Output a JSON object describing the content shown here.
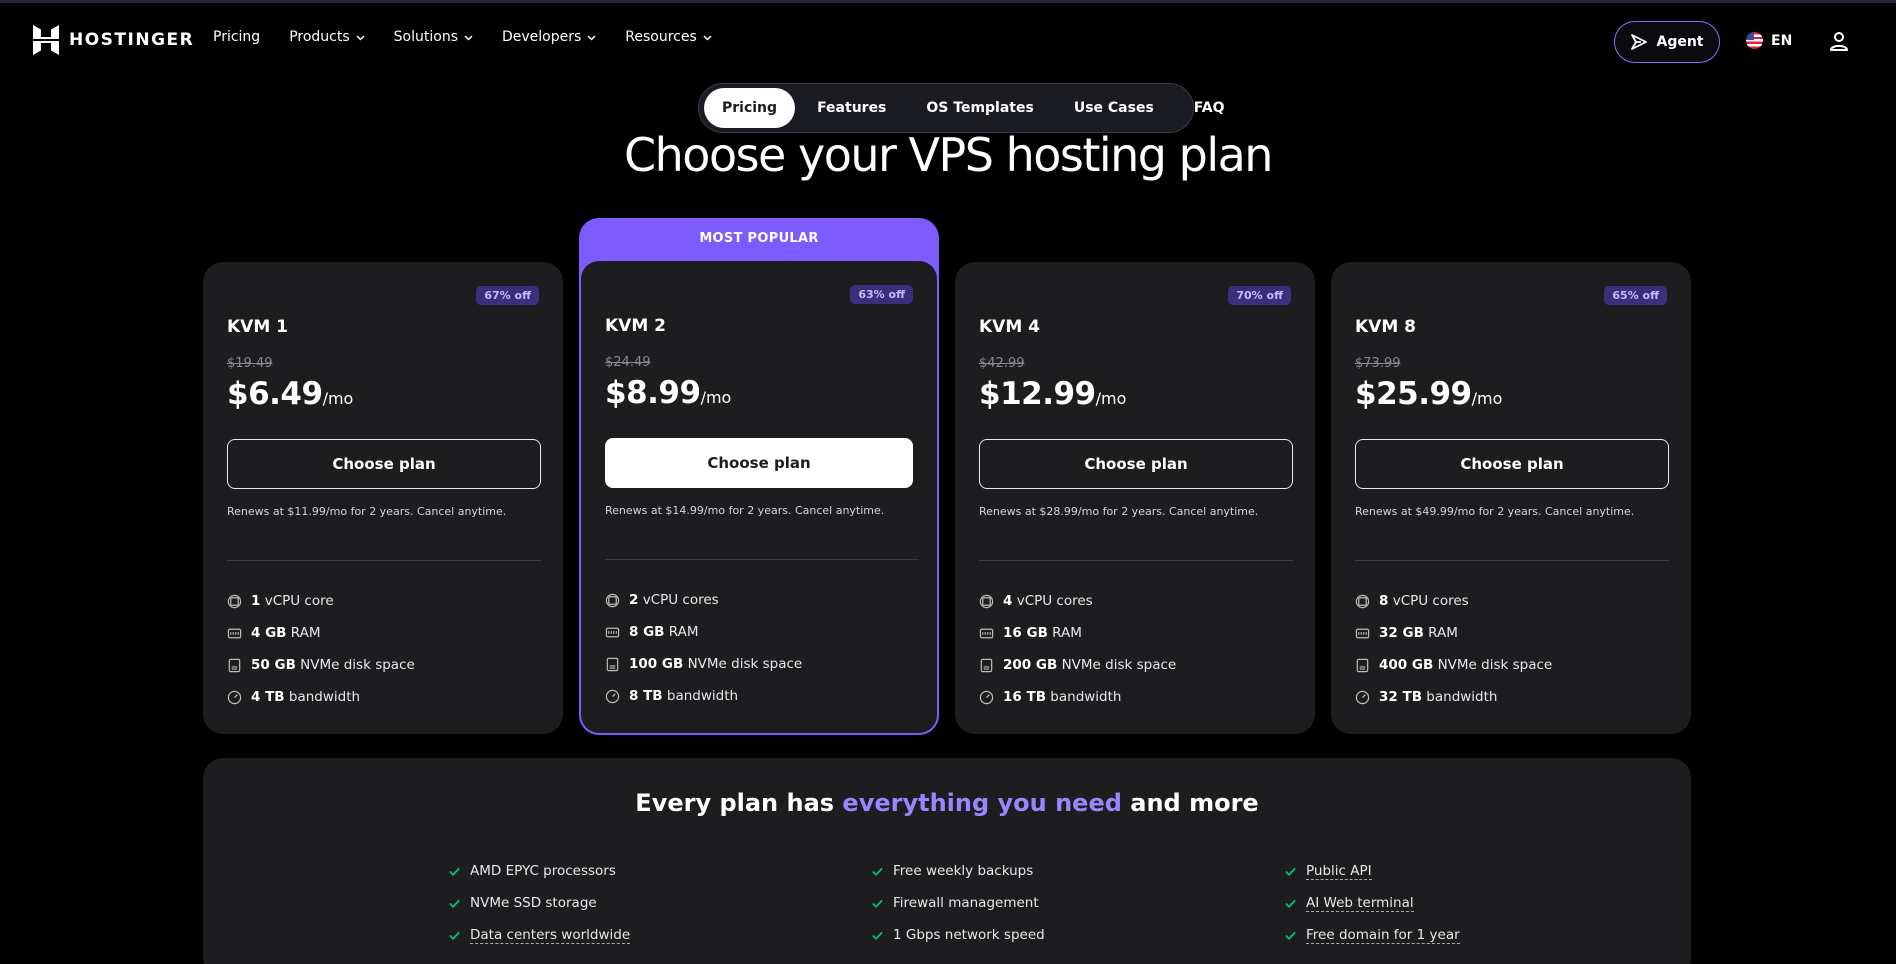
{
  "brand": {
    "name": "HOSTINGER"
  },
  "nav": {
    "links": [
      {
        "label": "Pricing",
        "dropdown": false
      },
      {
        "label": "Products",
        "dropdown": true
      },
      {
        "label": "Solutions",
        "dropdown": true
      },
      {
        "label": "Developers",
        "dropdown": true
      },
      {
        "label": "Resources",
        "dropdown": true
      }
    ],
    "agent_label": "Agent",
    "language": "EN"
  },
  "tabs": [
    "Pricing",
    "Features",
    "OS Templates",
    "Use Cases",
    "FAQ"
  ],
  "active_tab": "Pricing",
  "hero": {
    "title": "Choose your VPS hosting plan"
  },
  "popular_label": "MOST POPULAR",
  "plans": [
    {
      "name": "KVM 1",
      "badge": "67% off",
      "old_price": "$19.49",
      "price": "$6.49",
      "unit": "/mo",
      "cta": "Choose plan",
      "renew": "Renews at $11.99/mo for 2 years. Cancel anytime.",
      "features": [
        {
          "value": "1",
          "text": "vCPU core"
        },
        {
          "value": "4 GB",
          "text": "RAM"
        },
        {
          "value": "50 GB",
          "text": "NVMe disk space"
        },
        {
          "value": "4 TB",
          "text": "bandwidth"
        }
      ]
    },
    {
      "name": "KVM 2",
      "badge": "63% off",
      "old_price": "$24.49",
      "price": "$8.99",
      "unit": "/mo",
      "cta": "Choose plan",
      "renew": "Renews at $14.99/mo for 2 years. Cancel anytime.",
      "features": [
        {
          "value": "2",
          "text": "vCPU cores"
        },
        {
          "value": "8 GB",
          "text": "RAM"
        },
        {
          "value": "100 GB",
          "text": "NVMe disk space"
        },
        {
          "value": "8 TB",
          "text": "bandwidth"
        }
      ]
    },
    {
      "name": "KVM 4",
      "badge": "70% off",
      "old_price": "$42.99",
      "price": "$12.99",
      "unit": "/mo",
      "cta": "Choose plan",
      "renew": "Renews at $28.99/mo for 2 years. Cancel anytime.",
      "features": [
        {
          "value": "4",
          "text": "vCPU cores"
        },
        {
          "value": "16 GB",
          "text": "RAM"
        },
        {
          "value": "200 GB",
          "text": "NVMe disk space"
        },
        {
          "value": "16 TB",
          "text": "bandwidth"
        }
      ]
    },
    {
      "name": "KVM 8",
      "badge": "65% off",
      "old_price": "$73.99",
      "price": "$25.99",
      "unit": "/mo",
      "cta": "Choose plan",
      "renew": "Renews at $49.99/mo for 2 years. Cancel anytime.",
      "features": [
        {
          "value": "8",
          "text": "vCPU cores"
        },
        {
          "value": "32 GB",
          "text": "RAM"
        },
        {
          "value": "400 GB",
          "text": "NVMe disk space"
        },
        {
          "value": "32 TB",
          "text": "bandwidth"
        }
      ]
    }
  ],
  "everything": {
    "title_before": "Every plan has ",
    "title_highlight": "everything you need",
    "title_after": " and more",
    "columns": [
      [
        {
          "text": "AMD EPYC processors",
          "link": false
        },
        {
          "text": "NVMe SSD storage",
          "link": false
        },
        {
          "text": "Data centers worldwide",
          "link": true
        }
      ],
      [
        {
          "text": "Free weekly backups",
          "link": false
        },
        {
          "text": "Firewall management",
          "link": false
        },
        {
          "text": "1 Gbps network speed",
          "link": false
        }
      ],
      [
        {
          "text": "Public API",
          "link": true
        },
        {
          "text": "AI Web terminal",
          "link": true
        },
        {
          "text": "Free domain for 1 year",
          "link": true
        }
      ]
    ]
  },
  "colors": {
    "accent": "#7c5cff",
    "card": "#1d1d1f",
    "check": "#00c47a"
  }
}
